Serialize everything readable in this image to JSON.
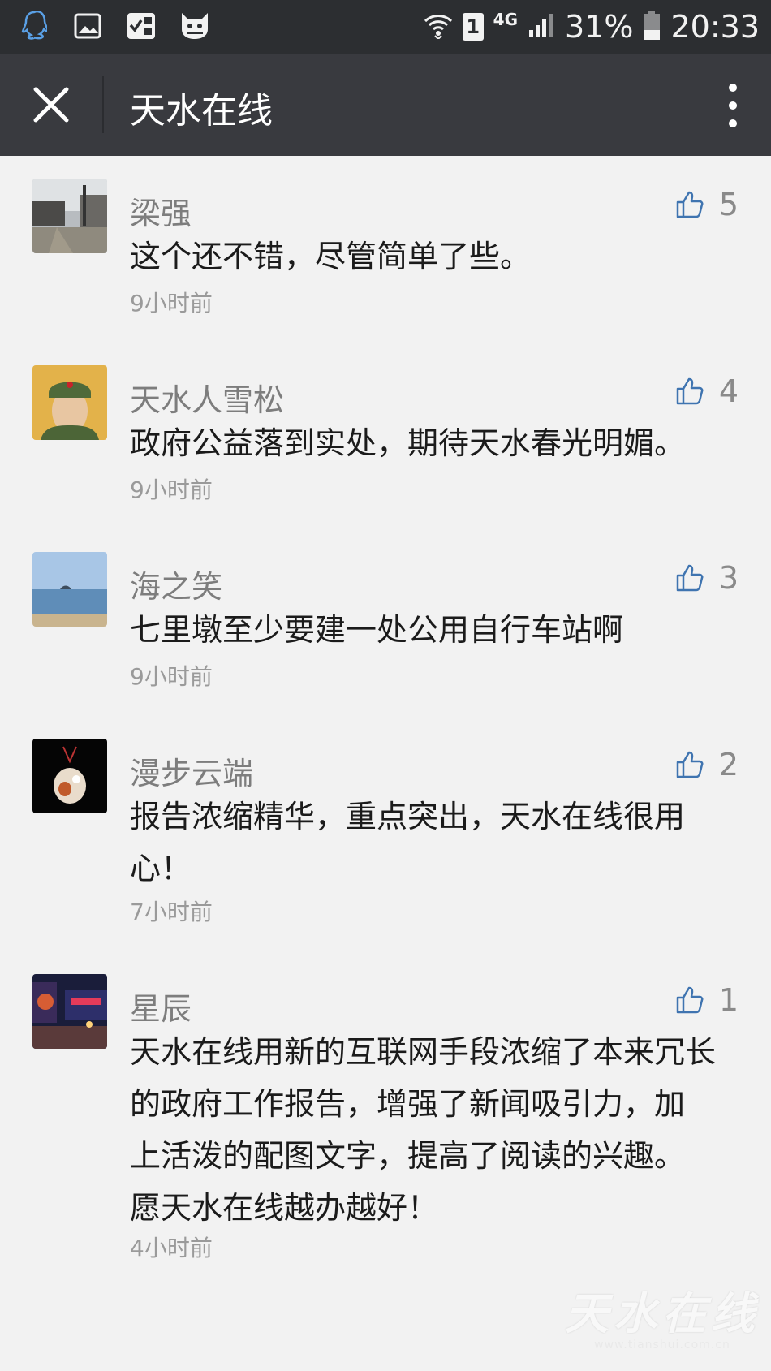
{
  "status_bar": {
    "sim_slot": "1",
    "network": "4G",
    "battery": "31%",
    "time": "20:33",
    "icons": [
      "qq-icon",
      "gallery-icon",
      "checklist-icon",
      "cat-app-icon",
      "wifi-icon",
      "signal-icon",
      "battery-icon"
    ]
  },
  "title_bar": {
    "title": "天水在线",
    "close_icon": "close-icon",
    "more_icon": "more-vertical-icon"
  },
  "comments": [
    {
      "name": "梁强",
      "likes": "5",
      "lines": [
        "这个还不错，尽管简单了些。"
      ],
      "time": "9小时前",
      "avatar": "street-scene-avatar"
    },
    {
      "name": "天水人雪松",
      "likes": "4",
      "lines": [
        "政府公益落到实处，期待天水春光明媚。"
      ],
      "time": "9小时前",
      "avatar": "soldier-portrait-avatar"
    },
    {
      "name": "海之笑",
      "likes": "3",
      "lines": [
        "七里墩至少要建一处公用自行车站啊"
      ],
      "time": "9小时前",
      "avatar": "seascape-avatar"
    },
    {
      "name": "漫步云端",
      "likes": "2",
      "lines": [
        "报告浓缩精华，重点突出，天水在线很用",
        "心！"
      ],
      "time": "7小时前",
      "avatar": "jade-pendant-avatar"
    },
    {
      "name": "星辰",
      "likes": "1",
      "lines": [
        "天水在线用新的互联网手段浓缩了本来冗长",
        "的政府工作报告，增强了新闻吸引力，加",
        "上活泼的配图文字，提高了阅读的兴趣。",
        "愿天水在线越办越好！"
      ],
      "time": "4小时前",
      "avatar": "night-street-avatar"
    }
  ],
  "watermark": {
    "logo_text": "天水在线",
    "url": "www.tianshui.com.cn"
  }
}
